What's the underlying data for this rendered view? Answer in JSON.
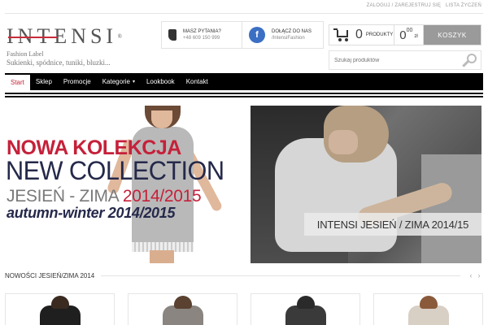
{
  "top_links": {
    "login": "ZALOGUJ / ZAREJESTRUJ SIĘ",
    "wishlist": "LISTA ŻYCZEŃ"
  },
  "brand": {
    "logo_text": "INTENSI",
    "reg_mark": "®",
    "tagline": "Fashion Label",
    "subtitle": "Sukienki, spódnice, tuniki, bluzki..."
  },
  "contact": {
    "phone_title": "MASZ PYTANIA?",
    "phone_number": "+48 609 150 999",
    "fb_title": "DOŁĄCZ DO NAS",
    "fb_handle": "/IntensiFashion",
    "fb_letter": "f"
  },
  "cart": {
    "count": "0",
    "count_label": "PRODUKTY",
    "total_main": "0",
    "total_cents": "00",
    "currency": "zł",
    "button": "KOSZYK"
  },
  "search": {
    "placeholder": "Szukaj produktów"
  },
  "nav": {
    "items": [
      {
        "label": "Start"
      },
      {
        "label": "Sklep"
      },
      {
        "label": "Promocje"
      },
      {
        "label": "Kategorie",
        "caret": "▾"
      },
      {
        "label": "Lookbook"
      },
      {
        "label": "Kontakt"
      }
    ]
  },
  "banner_left": {
    "line1": "NOWA KOLEKCJA",
    "line2": "NEW COLLECTION",
    "line3_prefix": "JESIEŃ - ZIMA ",
    "line3_year": "2014/2015",
    "line4": "autumn-winter 2014/2015"
  },
  "banner_right": {
    "caption": "INTENSI JESIEŃ / ZIMA 2014/15"
  },
  "section": {
    "title": "NOWOŚCI JESIEŃ/ZIMA 2014",
    "prev": "‹",
    "next": "›"
  },
  "colors": {
    "accent": "#c4263a",
    "nav_bg": "#000000",
    "navy": "#25294a",
    "facebook": "#3b6fc4"
  },
  "products": [
    {
      "hair": "#3a2a20",
      "top": "#1f1f1f"
    },
    {
      "hair": "#5a4130",
      "top": "#8a8580"
    },
    {
      "hair": "#2a2a2a",
      "top": "#3a3a3a"
    },
    {
      "hair": "#8a5a3a",
      "top": "#d8cfc5"
    }
  ]
}
